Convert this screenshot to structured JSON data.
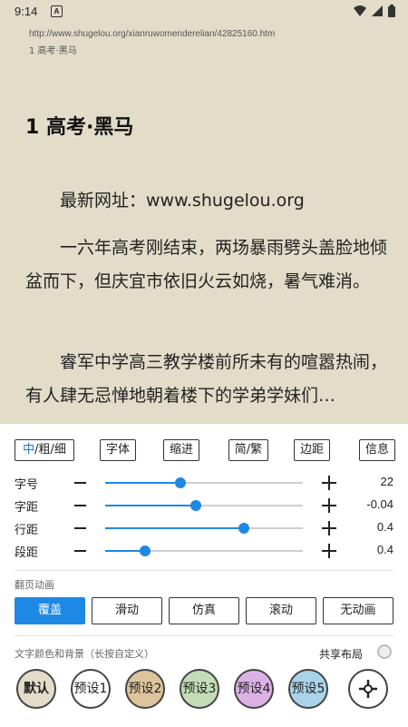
{
  "status": {
    "time": "9:14",
    "notification_glyph": "A"
  },
  "page": {
    "url": "http://www.shugelou.org/xianruwomenderelian/42825160.htm",
    "chapter_small": "1 高考·黑马",
    "chapter_title": "1 高考·黑马",
    "paragraphs": [
      "最新网址：www.shugelou.org",
      "一六年高考刚结束，两场暴雨劈头盖脸地倾盆而下，但庆宜市依旧火云如烧，暑气难消。",
      "睿军中学高三教学楼前所未有的喧嚣热闹，有人肆无忌惮地朝着楼下的学弟学妹们…"
    ]
  },
  "toolbar": {
    "weight_mid": "中",
    "weight_rest": "/粗/细",
    "font": "字体",
    "indent": "缩进",
    "simp_trad": "简/繁",
    "margin": "边距",
    "info": "信息"
  },
  "sliders": [
    {
      "label": "字号",
      "value": "22",
      "level": 0.38
    },
    {
      "label": "字距",
      "value": "-0.04",
      "level": 0.46
    },
    {
      "label": "行距",
      "value": "0.4",
      "level": 0.7
    },
    {
      "label": "段距",
      "value": "0.4",
      "level": 0.2
    }
  ],
  "page_anim": {
    "title": "翻页动画",
    "options": [
      "覆盖",
      "滑动",
      "仿真",
      "滚动",
      "无动画"
    ],
    "selected": "覆盖"
  },
  "colors_section": {
    "title": "文字颜色和背景（长按自定义）",
    "shared_layout": "共享布局",
    "presets": [
      {
        "label": "默认",
        "color": "#e2dcc9"
      },
      {
        "label": "预设1",
        "color": "#ffffff"
      },
      {
        "label": "预设2",
        "color": "#ddc49c"
      },
      {
        "label": "预设3",
        "color": "#c3ddb8"
      },
      {
        "label": "预设4",
        "color": "#dcb2e6"
      },
      {
        "label": "预设5",
        "color": "#a9d3e8"
      }
    ]
  },
  "accent": "#1e88e5"
}
